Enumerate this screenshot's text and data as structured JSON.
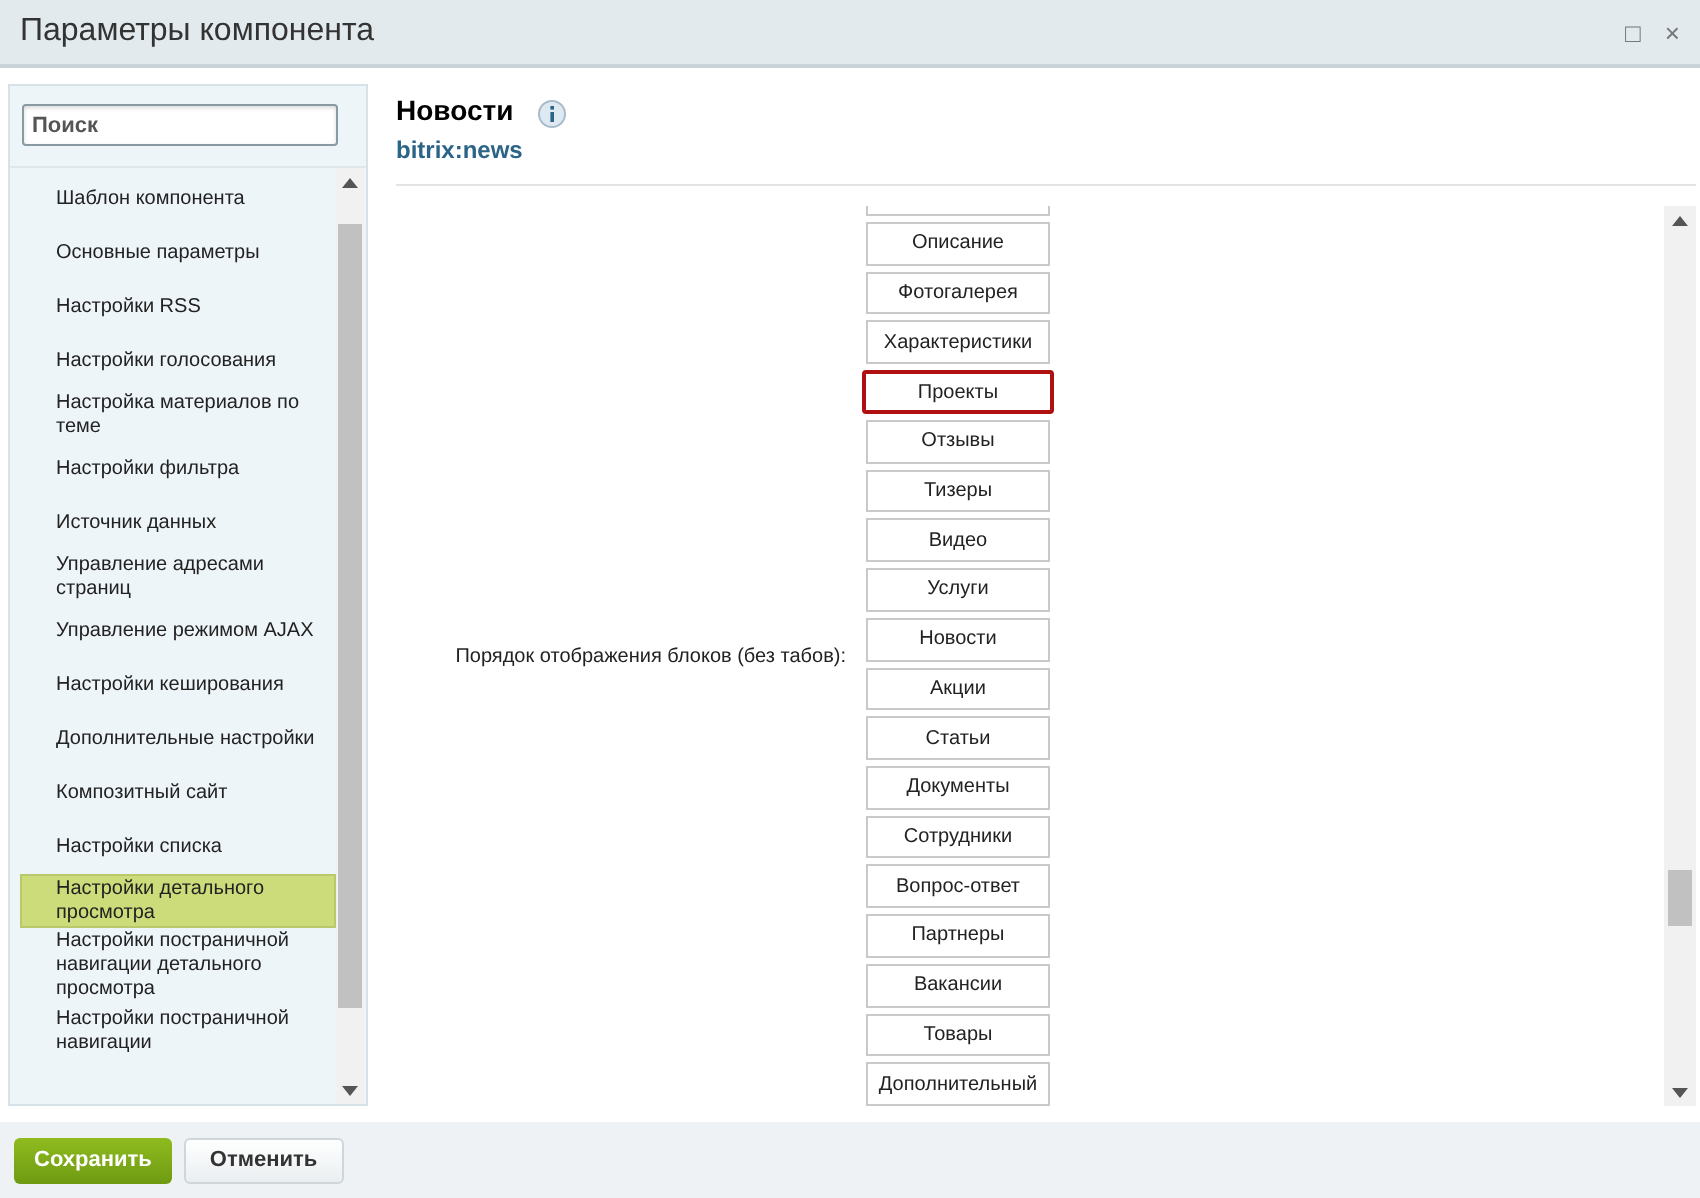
{
  "window": {
    "title": "Параметры компонента",
    "controls": [
      "□",
      "×"
    ]
  },
  "search": {
    "placeholder": "Поиск"
  },
  "sidebar": {
    "items": [
      {
        "label": "Шаблон компонента",
        "selected": false
      },
      {
        "label": "Основные параметры",
        "selected": false
      },
      {
        "label": "Настройки RSS",
        "selected": false
      },
      {
        "label": "Настройки голосования",
        "selected": false
      },
      {
        "label": "Настройка материалов по теме",
        "selected": false
      },
      {
        "label": "Настройки фильтра",
        "selected": false
      },
      {
        "label": "Источник данных",
        "selected": false
      },
      {
        "label": "Управление адресами страниц",
        "selected": false
      },
      {
        "label": "Управление режимом AJAX",
        "selected": false
      },
      {
        "label": "Настройки кеширования",
        "selected": false
      },
      {
        "label": "Дополнительные настройки",
        "selected": false
      },
      {
        "label": "Композитный сайт",
        "selected": false
      },
      {
        "label": "Настройки списка",
        "selected": false
      },
      {
        "label": "Настройки детального просмотра",
        "selected": true
      },
      {
        "label": "Настройки постраничной навигации детального просмотра",
        "selected": false
      },
      {
        "label": "Настройки постраничной навигации",
        "selected": false
      }
    ]
  },
  "component": {
    "name": "Новости",
    "code": "bitrix:news"
  },
  "setting": {
    "label": "Порядок отображения блоков (без табов):",
    "partial_item_above": true,
    "items": [
      {
        "label": "Описание",
        "highlighted": false
      },
      {
        "label": "Фотогалерея",
        "highlighted": false
      },
      {
        "label": "Характеристики",
        "highlighted": false
      },
      {
        "label": "Проекты",
        "highlighted": true
      },
      {
        "label": "Отзывы",
        "highlighted": false
      },
      {
        "label": "Тизеры",
        "highlighted": false
      },
      {
        "label": "Видео",
        "highlighted": false
      },
      {
        "label": "Услуги",
        "highlighted": false
      },
      {
        "label": "Новости",
        "highlighted": false
      },
      {
        "label": "Акции",
        "highlighted": false
      },
      {
        "label": "Статьи",
        "highlighted": false
      },
      {
        "label": "Документы",
        "highlighted": false
      },
      {
        "label": "Сотрудники",
        "highlighted": false
      },
      {
        "label": "Вопрос-ответ",
        "highlighted": false
      },
      {
        "label": "Партнеры",
        "highlighted": false
      },
      {
        "label": "Вакансии",
        "highlighted": false
      },
      {
        "label": "Товары",
        "highlighted": false
      },
      {
        "label": "Дополнительный",
        "highlighted": false
      }
    ]
  },
  "buttons": [
    {
      "label": "Сохранить",
      "kind": "primary"
    },
    {
      "label": "Отменить",
      "kind": "secondary"
    }
  ]
}
